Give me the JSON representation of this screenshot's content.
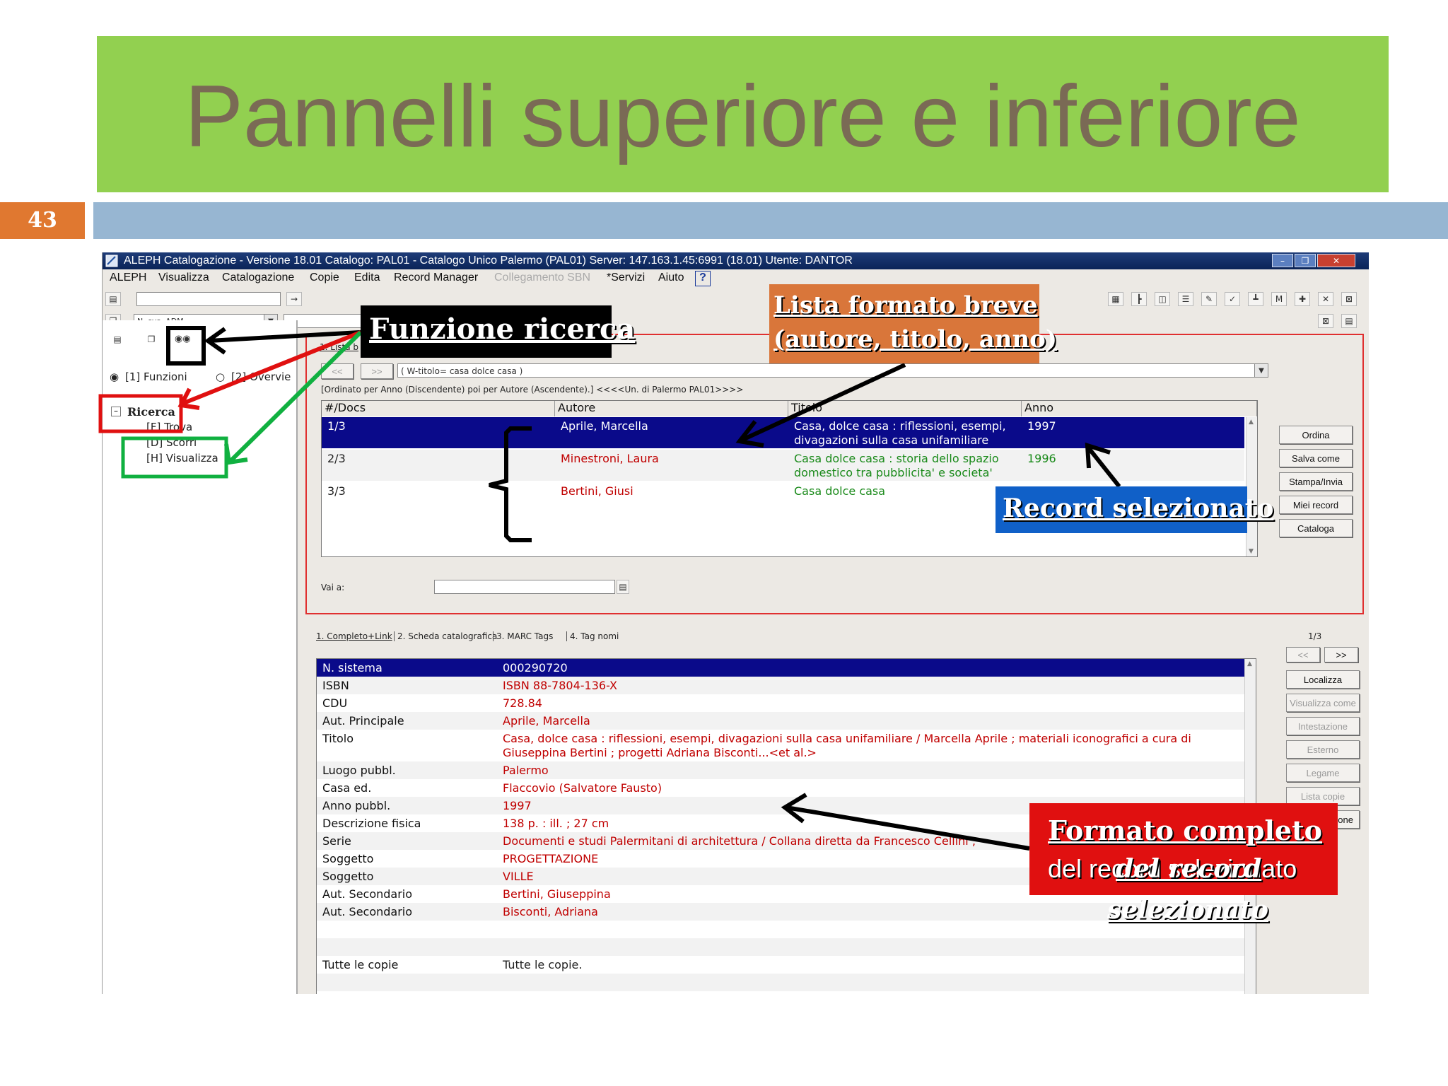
{
  "slide": {
    "title": "Pannelli superiore e inferiore",
    "number": "43",
    "colors": {
      "title_band": "#92d050",
      "number_box": "#e07830",
      "blue_band": "#97b6d2",
      "title_text": "#7a6a55"
    }
  },
  "window": {
    "title": "ALEPH Catalogazione - Versione 18.01  Catalogo:  PAL01 - Catalogo Unico Palermo (PAL01)  Server:  147.163.1.45:6991 (18.01)  Utente:  DANTOR",
    "controls": [
      "minimize-icon",
      "restore-icon",
      "close-icon"
    ],
    "menu": [
      {
        "label": "ALEPH",
        "enabled": true
      },
      {
        "label": "Visualizza",
        "enabled": true
      },
      {
        "label": "Catalogazione",
        "enabled": true
      },
      {
        "label": "Copie",
        "enabled": true
      },
      {
        "label": "Edita",
        "enabled": true
      },
      {
        "label": "Record Manager",
        "enabled": true
      },
      {
        "label": "Collegamento SBN",
        "enabled": false
      },
      {
        "label": "*Servizi",
        "enabled": true
      },
      {
        "label": "Aiuto",
        "enabled": true
      },
      {
        "label": "?",
        "enabled": true
      }
    ]
  },
  "toolbar": {
    "sys_field": "N. sys. ADM"
  },
  "left_panel": {
    "radio_functions": "[1] Funzioni",
    "radio_overview": "[2] Overvie",
    "tree_root": "Ricerca",
    "tree_items": [
      "[F] Trova",
      "[D] Scorri",
      "[H] Visualizza"
    ]
  },
  "results": {
    "tab": "1. Lista b",
    "nav_prev": "<<",
    "nav_next": ">>",
    "query": "( W-titolo= casa dolce casa )",
    "sort_info": "[Ordinato per Anno (Discendente) poi per Autore (Ascendente).]   <<<<Un. di Palermo PAL01>>>>",
    "columns": [
      "#/Docs",
      "Autore",
      "Titolo",
      "Anno"
    ],
    "rows": [
      {
        "num": "1/3",
        "author": "Aprile, Marcella",
        "title1": "Casa, dolce casa : riflessioni, esempi,",
        "title2": "divagazioni sulla casa unifamiliare",
        "year": "1997",
        "selected": true
      },
      {
        "num": "2/3",
        "author": "Minestroni, Laura",
        "title1": "Casa dolce casa : storia dello spazio",
        "title2": "domestico tra pubblicita' e societa'",
        "year": "1996",
        "selected": false
      },
      {
        "num": "3/3",
        "author": "Bertini, Giusi",
        "title1": "Casa dolce casa",
        "title2": "",
        "year": "",
        "selected": false
      }
    ],
    "goto_label": "Vai a:",
    "side_buttons": [
      "Ordina",
      "Salva come",
      "Stampa/Invia",
      "Miei record",
      "Cataloga"
    ]
  },
  "record": {
    "tabs": [
      "1. Completo+Link",
      "2. Scheda catalografica",
      "3. MARC Tags",
      "4. Tag nomi"
    ],
    "counter": "1/3",
    "nav_prev": "<<",
    "nav_next": ">>",
    "fields": [
      {
        "label": "N. sistema",
        "value": "000290720"
      },
      {
        "label": "ISBN",
        "value": "ISBN 88-7804-136-X"
      },
      {
        "label": "CDU",
        "value": "728.84"
      },
      {
        "label": "Aut. Principale",
        "value": "Aprile, Marcella"
      },
      {
        "label": "Titolo",
        "value": "Casa, dolce casa : riflessioni, esempi, divagazioni sulla casa unifamiliare / Marcella Aprile ; materiali iconografici a cura di",
        "value2": "Giuseppina Bertini ; progetti Adriana Bisconti...<et al.>"
      },
      {
        "label": "Luogo pubbl.",
        "value": "Palermo"
      },
      {
        "label": "Casa ed.",
        "value": "Flaccovio (Salvatore Fausto)"
      },
      {
        "label": "Anno pubbl.",
        "value": "1997"
      },
      {
        "label": "Descrizione fisica",
        "value": "138 p. : ill. ; 27 cm"
      },
      {
        "label": "Serie",
        "value": "Documenti e studi Palermitani di architettura / Collana diretta da Francesco Cellini ;"
      },
      {
        "label": "Soggetto",
        "value": "PROGETTAZIONE"
      },
      {
        "label": "Soggetto",
        "value": "VILLE"
      },
      {
        "label": "Aut. Secondario",
        "value": "Bertini, Giuseppina"
      },
      {
        "label": "Aut. Secondario",
        "value": "Bisconti, Adriana"
      }
    ],
    "copies_label": "Tutte le copie",
    "copies_value": "Tutte le copie.",
    "side_buttons": [
      {
        "label": "Localizza",
        "enabled": true
      },
      {
        "label": "Visualizza come",
        "enabled": false
      },
      {
        "label": "Intestazione",
        "enabled": false
      },
      {
        "label": "Esterno",
        "enabled": false
      },
      {
        "label": "Legame",
        "enabled": false
      },
      {
        "label": "Lista copie",
        "enabled": false
      },
      {
        "label": "one",
        "enabled": true
      }
    ]
  },
  "callouts": {
    "funzione_ricerca": "Funzione ricerca",
    "lista_breve_1": "Lista formato breve",
    "lista_breve_2": "(autore, titolo, anno)",
    "record_selezionato": "Record selezionato",
    "formato_completo_1": "Formato completo",
    "formato_completo_2": "del record selezionato",
    "overlay_1": "del record",
    "overlay_2": "selezionato",
    "colors": {
      "orange": "#d9763a",
      "blue": "#1060c8",
      "red": "#e01010",
      "black": "#000000",
      "green": "#10b040"
    }
  }
}
